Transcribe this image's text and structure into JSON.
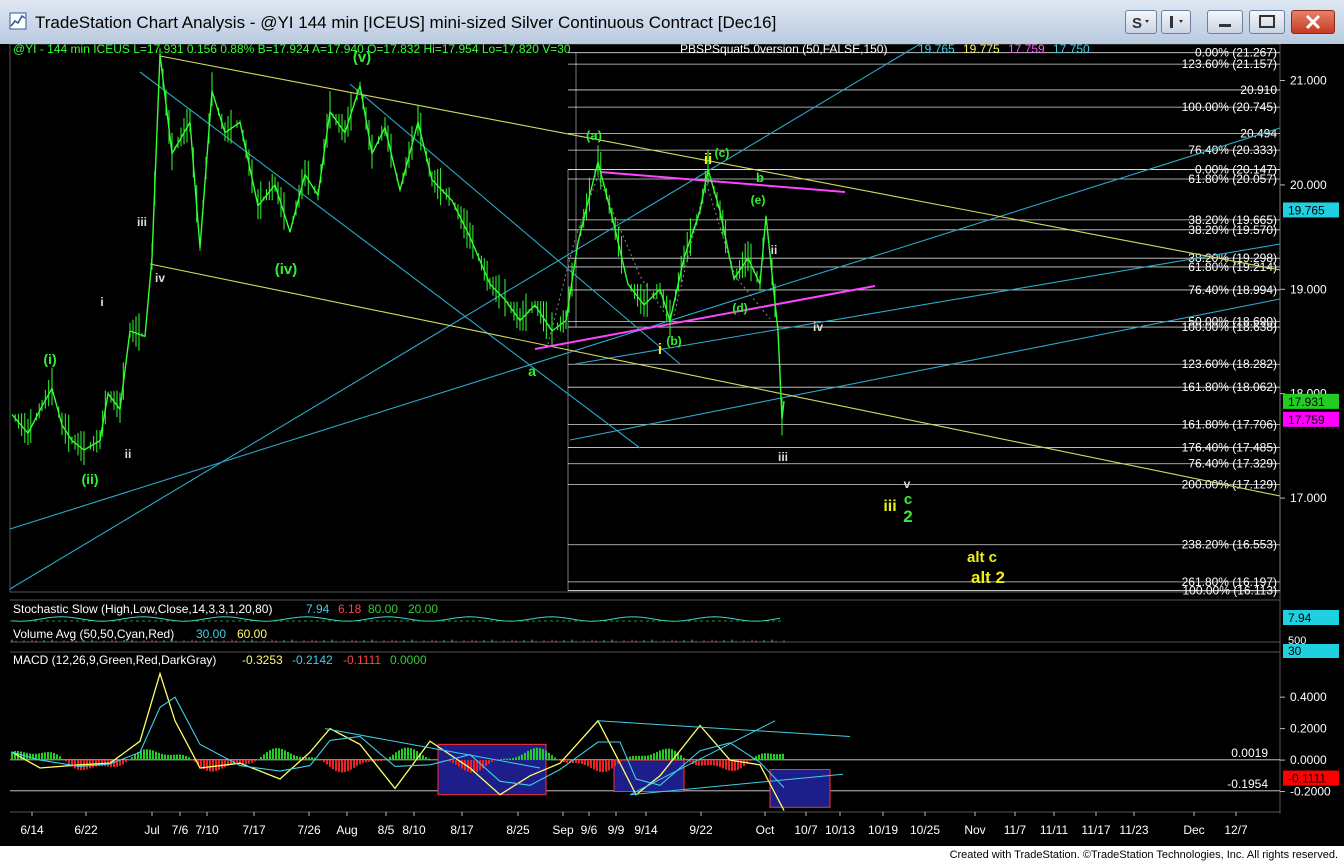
{
  "window": {
    "title": "TradeStation Chart Analysis - @YI 144 min [ICEUS] mini-sized Silver Continuous Contract [Dec16]"
  },
  "footer": {
    "credit": "Created with TradeStation. ©TradeStation Technologies, Inc. All rights reserved."
  },
  "header": {
    "quote": "@YI - 144 min  ICEUS  L=17.931  0.156  0.88%  B=17.924  A=17.940  O=17.832  Hi=17.954  Lo=17.820  V=30",
    "indicator_label": "PBSPSquat5.0version (50,FALSE,150)",
    "indicator_values": [
      {
        "text": "19.765",
        "color": "#3fd0e6"
      },
      {
        "text": "19.775",
        "color": "#f2f26a"
      },
      {
        "text": "17.759",
        "color": "#ff55ff"
      },
      {
        "text": "17.750",
        "color": "#3fd0e6"
      }
    ]
  },
  "colors": {
    "price": "#33ff33",
    "fib": "#ffffff",
    "channel_yellow": "#d8d860",
    "channel_cyan": "#2aa9c9",
    "magenta": "#ff44ff",
    "wave_green": "#33ee33",
    "wave_yellow": "#eeee22",
    "wave_white": "#dddddd",
    "last_price_bg": "#22cc22",
    "stoch_bg": "#ff00ff",
    "cyan_bg": "#1fd0e0"
  },
  "chart_data": [
    {
      "type": "line",
      "name": "price",
      "x_axis_labels": [
        "6/14",
        "6/22",
        "Jul",
        "7/6",
        "7/10",
        "7/17",
        "7/26",
        "Aug",
        "8/5",
        "8/10",
        "8/17",
        "8/25",
        "Sep",
        "9/6",
        "9/9",
        "9/14",
        "9/22",
        "Oct",
        "10/7",
        "10/13",
        "10/19",
        "10/25",
        "Nov",
        "11/7",
        "11/11",
        "11/17",
        "11/23",
        "Dec",
        "12/7"
      ],
      "y_axis": {
        "min": 16.1,
        "max": 21.35,
        "ticks": [
          "17.000",
          "18.000",
          "19.000",
          "20.000",
          "21.000"
        ]
      },
      "price_tags": [
        {
          "text": "19.765",
          "value": 19.765,
          "bg": "#1fd0e0",
          "fg": "#000000"
        },
        {
          "text": "17.931",
          "value": 17.931,
          "bg": "#22cc22",
          "fg": "#000000"
        },
        {
          "text": "17.759",
          "value": 17.759,
          "bg": "#ff00ff",
          "fg": "#000000"
        }
      ],
      "fib_levels": [
        {
          "text": "0.00% (21.267)",
          "value": 21.267
        },
        {
          "text": "123.60% (21.157)",
          "value": 21.157
        },
        {
          "text": "20.910",
          "value": 20.91
        },
        {
          "text": "100.00% (20.745)",
          "value": 20.745
        },
        {
          "text": "20.494",
          "value": 20.494
        },
        {
          "text": "76.40% (20.333)",
          "value": 20.333
        },
        {
          "text": "0.00% (20.147)",
          "value": 20.147
        },
        {
          "text": "61.80% (20.057)",
          "value": 20.057
        },
        {
          "text": "38.20% (19.665)",
          "value": 19.665
        },
        {
          "text": "38.20% (19.570)",
          "value": 19.57
        },
        {
          "text": "38.20% (19.298)",
          "value": 19.298
        },
        {
          "text": "61.80% (19.214)",
          "value": 19.214
        },
        {
          "text": "76.40% (18.994)",
          "value": 18.994
        },
        {
          "text": "50.00% (18.690)",
          "value": 18.69
        },
        {
          "text": "100.00% (18.638)",
          "value": 18.638
        },
        {
          "text": "123.60% (18.282)",
          "value": 18.282
        },
        {
          "text": "161.80% (18.062)",
          "value": 18.062
        },
        {
          "text": "161.80% (17.706)",
          "value": 17.706
        },
        {
          "text": "176.40% (17.485)",
          "value": 17.485
        },
        {
          "text": "76.40% (17.329)",
          "value": 17.329
        },
        {
          "text": "200.00% (17.129)",
          "value": 17.129
        },
        {
          "text": "238.20% (16.553)",
          "value": 16.553
        },
        {
          "text": "261.80% (16.197)",
          "value": 16.197
        },
        {
          "text": "100.00% (16.113)",
          "value": 16.113
        }
      ],
      "wave_labels": [
        {
          "text": "(i)",
          "color": "#33ee33"
        },
        {
          "text": "(ii)",
          "color": "#33ee33"
        },
        {
          "text": "i",
          "color": "#dddddd"
        },
        {
          "text": "ii",
          "color": "#dddddd"
        },
        {
          "text": "iii",
          "color": "#dddddd"
        },
        {
          "text": "iv",
          "color": "#dddddd"
        },
        {
          "text": "(iv)",
          "color": "#33ee33"
        },
        {
          "text": "(v)",
          "color": "#33ee33"
        },
        {
          "text": "a",
          "color": "#33ee33"
        },
        {
          "text": "(a)",
          "color": "#33ee33"
        },
        {
          "text": "(b)",
          "color": "#33ee33"
        },
        {
          "text": "i",
          "color": "#eeee22"
        },
        {
          "text": "ii",
          "color": "#eeee22"
        },
        {
          "text": "(c)",
          "color": "#33ee33"
        },
        {
          "text": "b",
          "color": "#33ee33"
        },
        {
          "text": "(e)",
          "color": "#33ee33"
        },
        {
          "text": "(d)",
          "color": "#33ee33"
        },
        {
          "text": "ii",
          "color": "#dddddd"
        },
        {
          "text": "iv",
          "color": "#dddddd"
        },
        {
          "text": "iii",
          "color": "#dddddd"
        },
        {
          "text": "v",
          "color": "#dddddd"
        },
        {
          "text": "iii",
          "color": "#eeee22"
        },
        {
          "text": "c",
          "color": "#33ee33"
        },
        {
          "text": "2",
          "color": "#33ee33"
        },
        {
          "text": "alt c",
          "color": "#eeee22"
        },
        {
          "text": "alt 2",
          "color": "#eeee22"
        }
      ]
    },
    {
      "type": "line",
      "name": "Stochastic Slow",
      "label": "Stochastic Slow (High,Low,Close,14,3,3,1,20,80)",
      "values": [
        {
          "text": "7.94",
          "color": "#3fd0e6"
        },
        {
          "text": "6.18",
          "color": "#ff4444"
        },
        {
          "text": "80.00",
          "color": "#33cc33"
        },
        {
          "text": "20.00",
          "color": "#33cc33"
        }
      ],
      "price_tag": {
        "text": "7.94",
        "bg": "#1fd0e0",
        "fg": "#000000"
      }
    },
    {
      "type": "bar",
      "name": "Volume Avg",
      "label": "Volume Avg (50,50,Cyan,Red)",
      "values": [
        {
          "text": "30.00",
          "color": "#3fd0e6"
        },
        {
          "text": "60.00",
          "color": "#ffff66"
        }
      ],
      "axis_labels": [
        "500"
      ],
      "price_tag": {
        "text": "30",
        "bg": "#1fd0e0",
        "fg": "#000000"
      }
    },
    {
      "type": "line",
      "name": "MACD",
      "label": "MACD (12,26,9,Green,Red,DarkGray)",
      "values": [
        {
          "text": "-0.3253",
          "color": "#ffff66"
        },
        {
          "text": "-0.2142",
          "color": "#3fd0e6"
        },
        {
          "text": "-0.1111",
          "color": "#ff4444"
        },
        {
          "text": "0.0000",
          "color": "#33cc33"
        }
      ],
      "y_axis": {
        "min": -0.33,
        "max": 0.56,
        "ticks": [
          "0.4000",
          "0.2000",
          "0.0000",
          "-0.2000"
        ]
      },
      "level_labels": [
        {
          "text": "0.0019",
          "value": 0.0019
        },
        {
          "text": "-0.1954",
          "value": -0.1954
        }
      ],
      "price_tag": {
        "text": "-0.1111",
        "value": -0.1111,
        "bg": "#ff0000",
        "fg": "#000000"
      }
    }
  ]
}
